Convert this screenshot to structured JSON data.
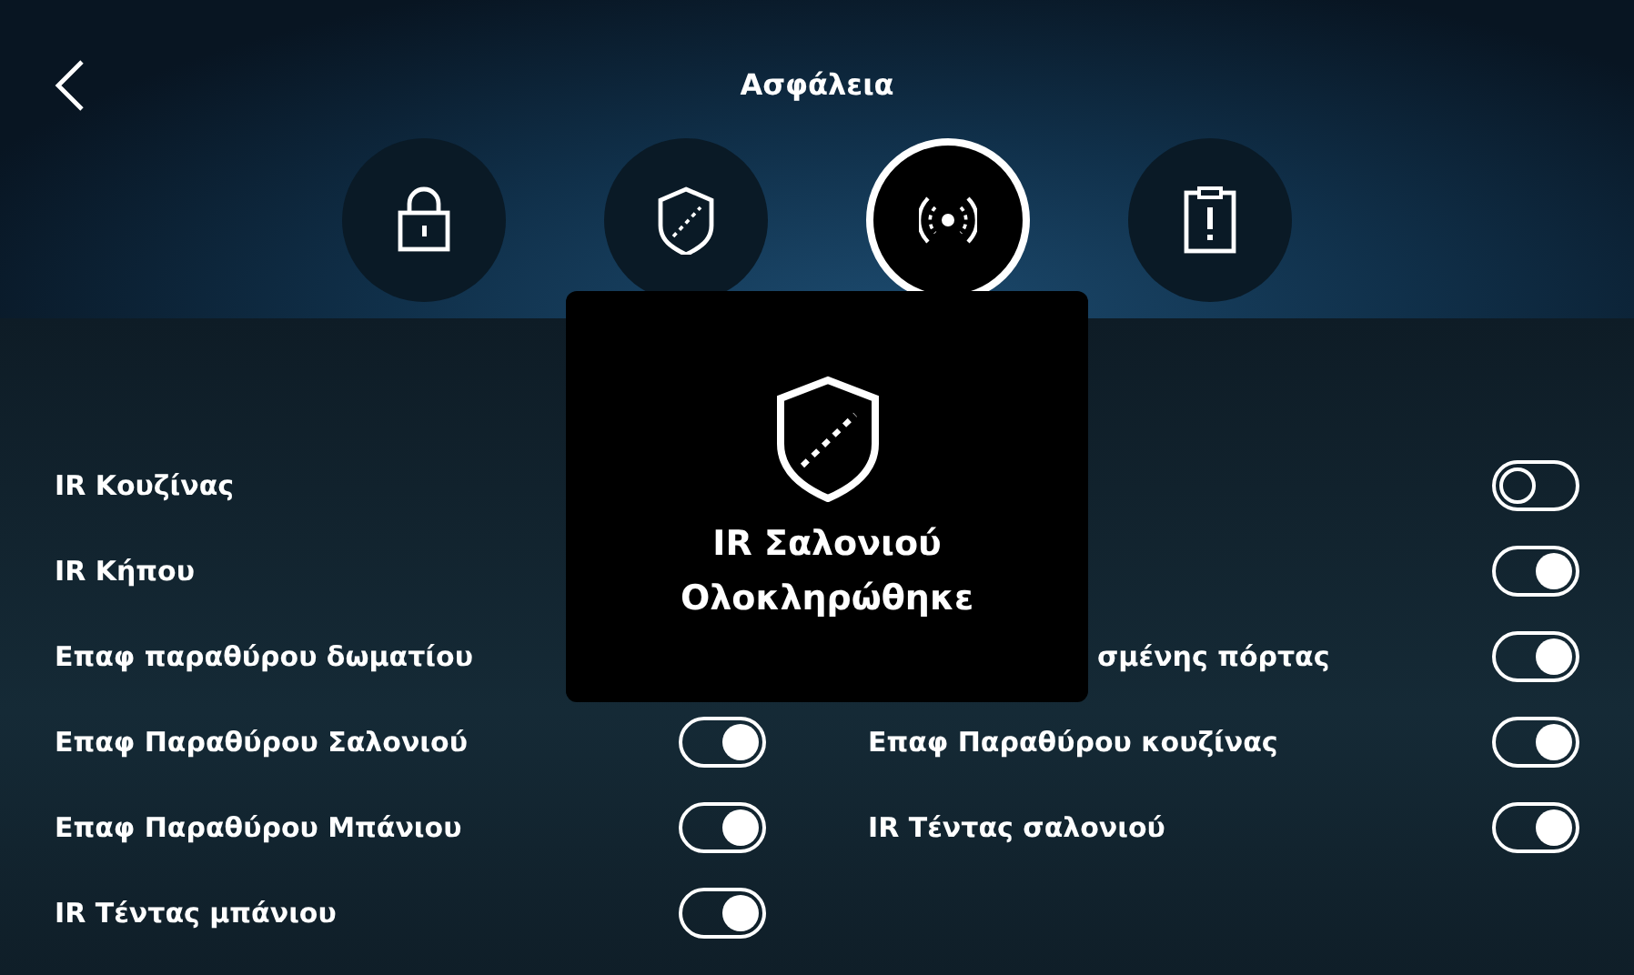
{
  "header": {
    "title": "Ασφάλεια"
  },
  "tabs": [
    {
      "kind": "lock",
      "selected": false
    },
    {
      "kind": "shield",
      "selected": false
    },
    {
      "kind": "sensor",
      "selected": true
    },
    {
      "kind": "alert",
      "selected": false
    }
  ],
  "zones_left": [
    {
      "name": "IR Κουζίνας"
    },
    {
      "name": "IR Κήπου"
    },
    {
      "name": "Επαφ παραθύρου δωματίου"
    },
    {
      "name": "Επαφ Παραθύρου Σαλονιού",
      "on": true
    },
    {
      "name": "Επαφ Παραθύρου Μπάνιου",
      "on": true
    },
    {
      "name": "IR Τέντας μπάνιου",
      "on": true
    }
  ],
  "zones_right": [
    {
      "on": false
    },
    {
      "on": true
    },
    {
      "name": "σμένης πόρτας",
      "partly_hidden": true,
      "on": true
    },
    {
      "name": "Επαφ Παραθύρου κουζίνας",
      "on": true
    },
    {
      "name": "IR Τέντας σαλονιού",
      "on": true
    }
  ],
  "toast": {
    "title": "IR Σαλονιού",
    "status": "Ολοκληρώθηκε"
  }
}
